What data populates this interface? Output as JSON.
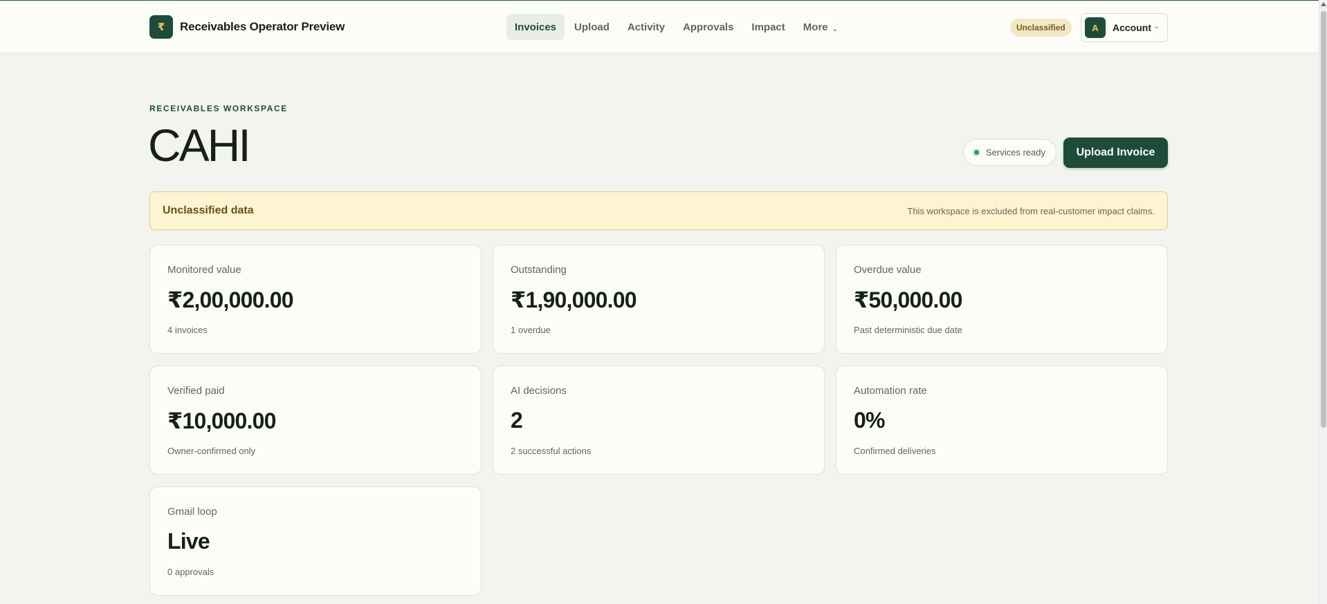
{
  "brand": {
    "logo_glyph": "₹",
    "name": "Receivables Operator Preview"
  },
  "nav": {
    "items": [
      {
        "label": "Invoices",
        "active": true
      },
      {
        "label": "Upload",
        "active": false
      },
      {
        "label": "Activity",
        "active": false
      },
      {
        "label": "Approvals",
        "active": false
      },
      {
        "label": "Impact",
        "active": false
      },
      {
        "label": "More",
        "active": false,
        "icon": "chevron-down-icon"
      }
    ]
  },
  "header": {
    "classification_badge": "Unclassified",
    "account": {
      "avatar_initial": "A",
      "label": "Account"
    }
  },
  "workspace": {
    "eyebrow": "RECEIVABLES WORKSPACE",
    "title": "CAHI",
    "status_label": "Services ready",
    "upload_button": "Upload Invoice"
  },
  "banner": {
    "title": "Unclassified data",
    "text": "This workspace is excluded from real-customer impact claims."
  },
  "metrics": [
    {
      "label": "Monitored value",
      "value": "₹2,00,000.00",
      "sub": "4 invoices"
    },
    {
      "label": "Outstanding",
      "value": "₹1,90,000.00",
      "sub": "1 overdue"
    },
    {
      "label": "Overdue value",
      "value": "₹50,000.00",
      "sub": "Past deterministic due date"
    },
    {
      "label": "Verified paid",
      "value": "₹10,000.00",
      "sub": "Owner-confirmed only"
    },
    {
      "label": "AI decisions",
      "value": "2",
      "sub": "2 successful actions"
    },
    {
      "label": "Automation rate",
      "value": "0%",
      "sub": "Confirmed deliveries"
    },
    {
      "label": "Gmail loop",
      "value": "Live",
      "sub": "0 approvals"
    }
  ],
  "colors": {
    "brand_green": "#1d4d3a",
    "page_background": "#f3f3ef",
    "banner_background": "#fdf4d2",
    "status_green": "#2a9b5a"
  }
}
